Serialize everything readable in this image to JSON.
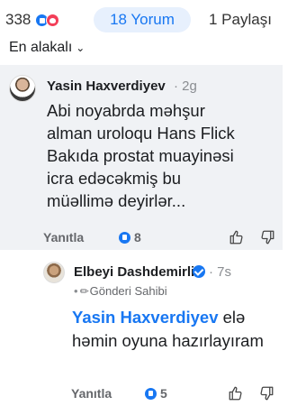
{
  "stats": {
    "reaction_count": "338",
    "reaction_icons": [
      "like-icon",
      "love-icon"
    ],
    "comments_label": "18 Yorum",
    "shares_label": "1 Paylaşı"
  },
  "sort": {
    "label": "En alakalı",
    "icon": "chevron-down-icon"
  },
  "comments": [
    {
      "author": "Yasin Haxverdiyev",
      "time": "· 2g",
      "body": "Abi noyabrda məhşur\nalman uroloqu Hans Flick\nBakıda prostat muayinəsi\nicra edəcəkmiş bu\nmüəllimə deyirlər...",
      "reply_label": "Yanıtla",
      "like_count": "8"
    },
    {
      "author": "Elbeyi Dashdemirli",
      "time": "· 7s",
      "badge_label": "Gönderi Sahibi",
      "mention": "Yasin Haxverdiyev",
      "body_rest": " elə həmin oyuna hazırlayıram",
      "reply_label": "Yanıtla",
      "like_count": "5"
    }
  ],
  "colors": {
    "accent": "#1877f2",
    "comment_bg": "#f0f2f5",
    "muted": "#65676b"
  }
}
